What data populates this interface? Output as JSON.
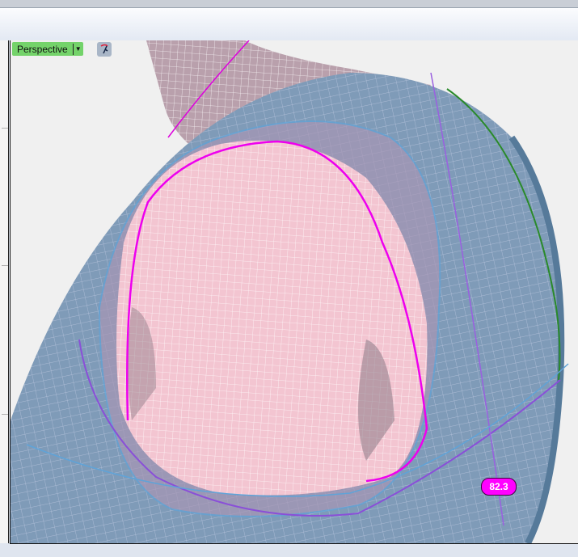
{
  "viewport": {
    "name": "Perspective",
    "dropdown_icon": "caret-down-icon",
    "gumball_icon": "gumball-icon",
    "measurement": "82.3"
  },
  "colors": {
    "viewport_label": "#74d36a",
    "badge": "#ff00ff",
    "surface_pink": "#f3c5d1",
    "surface_blue": "#7f9bb8",
    "curve_magenta": "#ee00ee",
    "curve_purple": "#8a4fd8"
  }
}
